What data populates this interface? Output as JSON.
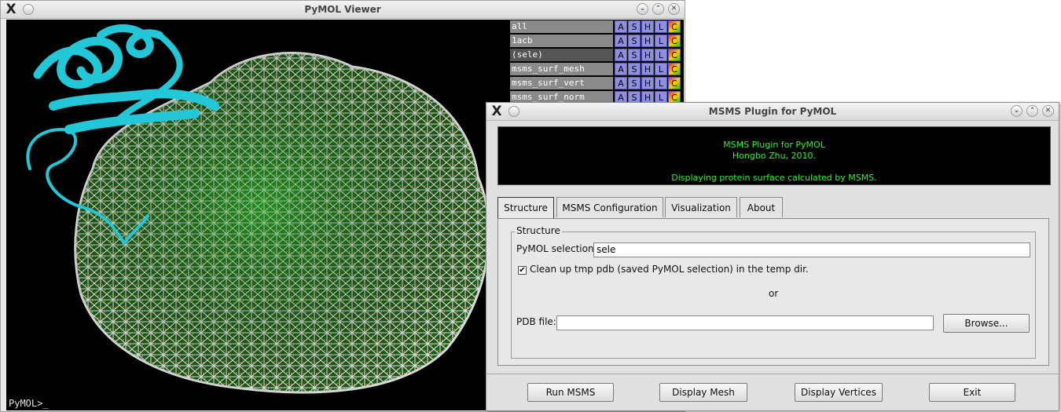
{
  "pymol": {
    "title": "PyMOL Viewer",
    "command_prompt": "PyMOL>_",
    "objects": [
      {
        "name": "all"
      },
      {
        "name": "1acb"
      },
      {
        "name": "(sele)"
      },
      {
        "name": "msms_surf_mesh"
      },
      {
        "name": "msms_surf_vert"
      },
      {
        "name": "msms_surf_norm"
      }
    ],
    "object_buttons": [
      "A",
      "S",
      "H",
      "L",
      "C"
    ]
  },
  "msms": {
    "title": "MSMS Plugin for PyMOL",
    "banner": {
      "line1": "MSMS Plugin for PyMOL",
      "line2": "Hongbo Zhu, 2010.",
      "line3": "Displaying protein surface calculated by MSMS."
    },
    "tabs": [
      "Structure",
      "MSMS Configuration",
      "Visualization",
      "About"
    ],
    "structure": {
      "group_label": "Structure",
      "pymol_selection_label": "PyMOL selection:",
      "pymol_selection_value": "sele",
      "cleanup_label": "Clean up tmp pdb (saved PyMOL selection) in the temp dir.",
      "cleanup_checked": true,
      "or_text": "or",
      "pdb_file_label": "PDB file:",
      "pdb_file_value": "",
      "browse_label": "Browse..."
    },
    "buttons": {
      "run": "Run MSMS",
      "display_mesh": "Display Mesh",
      "display_vertices": "Display Vertices",
      "exit": "Exit"
    }
  },
  "colors": {
    "banner_text": "#33ee33",
    "ribbon": "#22c8d8",
    "mesh": "#e8e8e8",
    "normals": "#e89a20"
  }
}
